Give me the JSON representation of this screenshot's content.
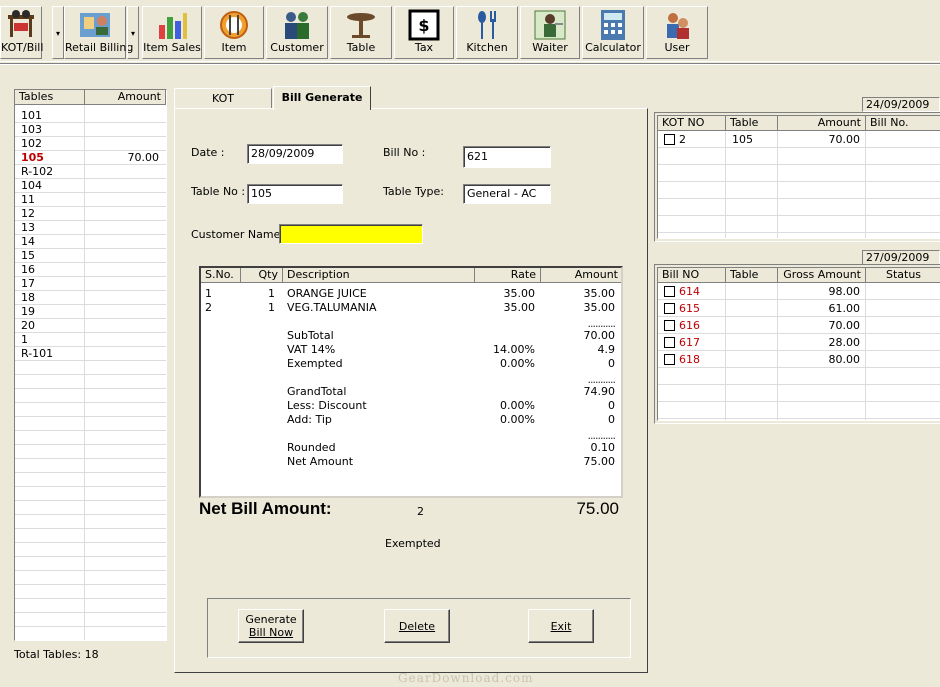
{
  "toolbar": {
    "buttons": [
      {
        "label": "KOT/Bill",
        "icon": "kot-bill-icon"
      },
      {
        "label": "Retail Billing",
        "icon": "retail-billing-icon"
      },
      {
        "label": "Item Sales",
        "icon": "item-sales-icon"
      },
      {
        "label": "Item",
        "icon": "item-icon"
      },
      {
        "label": "Customer",
        "icon": "customer-icon"
      },
      {
        "label": "Table",
        "icon": "table-icon"
      },
      {
        "label": "Tax",
        "icon": "tax-icon"
      },
      {
        "label": "Kitchen",
        "icon": "kitchen-icon"
      },
      {
        "label": "Waiter",
        "icon": "waiter-icon"
      },
      {
        "label": "Calculator",
        "icon": "calculator-icon"
      },
      {
        "label": "User",
        "icon": "user-icon"
      }
    ],
    "dropdown_glyph": "▾"
  },
  "tables_panel": {
    "headers": [
      "Tables",
      "Amount"
    ],
    "rows": [
      {
        "table": "101",
        "amount": ""
      },
      {
        "table": "103",
        "amount": ""
      },
      {
        "table": "102",
        "amount": ""
      },
      {
        "table": "105",
        "amount": "70.00"
      },
      {
        "table": "R-102",
        "amount": ""
      },
      {
        "table": "104",
        "amount": ""
      },
      {
        "table": "11",
        "amount": ""
      },
      {
        "table": "12",
        "amount": ""
      },
      {
        "table": "13",
        "amount": ""
      },
      {
        "table": "14",
        "amount": ""
      },
      {
        "table": "15",
        "amount": ""
      },
      {
        "table": "16",
        "amount": ""
      },
      {
        "table": "17",
        "amount": ""
      },
      {
        "table": "18",
        "amount": ""
      },
      {
        "table": "19",
        "amount": ""
      },
      {
        "table": "20",
        "amount": ""
      },
      {
        "table": "1",
        "amount": ""
      },
      {
        "table": "R-101",
        "amount": ""
      }
    ],
    "total_label": "Total Tables: 18"
  },
  "tabs": [
    {
      "label": "KOT",
      "active": false
    },
    {
      "label": "Bill Generate",
      "active": true
    }
  ],
  "form": {
    "date_label": "Date :",
    "date_value": "28/09/2009",
    "bill_no_label": "Bill No :",
    "bill_no_value": "621",
    "table_no_label": "Table No :",
    "table_no_value": "105",
    "table_type_label": "Table Type:",
    "table_type_value": "General - AC",
    "customer_name_label": "Customer Name :",
    "customer_name_value": ""
  },
  "bill_grid": {
    "headers": [
      "S.No.",
      "Qty",
      "Description",
      "Rate",
      "Amount"
    ],
    "items": [
      {
        "sno": "1",
        "qty": "1",
        "desc": "ORANGE JUICE",
        "rate": "35.00",
        "amount": "35.00"
      },
      {
        "sno": "2",
        "qty": "1",
        "desc": "VEG.TALUMANIA",
        "rate": "35.00",
        "amount": "35.00"
      }
    ],
    "summary": [
      {
        "desc": "SubTotal",
        "rate": "",
        "amount": "70.00",
        "rule_above": true
      },
      {
        "desc": "VAT 14%",
        "rate": "14.00%",
        "amount": "4.9",
        "rule_above": false
      },
      {
        "desc": "Exempted",
        "rate": "0.00%",
        "amount": "0",
        "rule_above": false
      },
      {
        "desc": "GrandTotal",
        "rate": "",
        "amount": "74.90",
        "rule_above": true
      },
      {
        "desc": "Less: Discount",
        "rate": "0.00%",
        "amount": "0",
        "rule_above": false
      },
      {
        "desc": "Add: Tip",
        "rate": "0.00%",
        "amount": "0",
        "rule_above": false
      },
      {
        "desc": "Rounded",
        "rate": "",
        "amount": "0.10",
        "rule_above": true
      },
      {
        "desc": "Net Amount",
        "rate": "",
        "amount": "75.00",
        "rule_above": false
      }
    ],
    "rule_text": "..........."
  },
  "net_bill": {
    "label": "Net Bill Amount:",
    "count": "2",
    "amount": "75.00",
    "exempted_label": "Exempted"
  },
  "actions": {
    "generate_line1": "Generate",
    "generate_line2": "Bill Now",
    "delete": "Delete",
    "exit": "Exit"
  },
  "kot_list": {
    "date": "24/09/2009",
    "headers": [
      "KOT NO",
      "Table",
      "Amount",
      "Bill No."
    ],
    "rows": [
      {
        "kot_no": "2",
        "table": "105",
        "amount": "70.00",
        "bill_no": ""
      }
    ]
  },
  "bill_list": {
    "date": "27/09/2009",
    "headers": [
      "Bill NO",
      "Table",
      "Gross Amount",
      "Status"
    ],
    "rows": [
      {
        "bill_no": "614",
        "table": "",
        "gross": "98.00",
        "status": ""
      },
      {
        "bill_no": "615",
        "table": "",
        "gross": "61.00",
        "status": ""
      },
      {
        "bill_no": "616",
        "table": "",
        "gross": "70.00",
        "status": ""
      },
      {
        "bill_no": "617",
        "table": "",
        "gross": "28.00",
        "status": ""
      },
      {
        "bill_no": "618",
        "table": "",
        "gross": "80.00",
        "status": ""
      }
    ]
  },
  "watermark": "GearDownload.com",
  "colors": {
    "window_bg": "#ece9d8",
    "highlight_red": "#c00000",
    "customer_field_bg": "#ffff00"
  }
}
